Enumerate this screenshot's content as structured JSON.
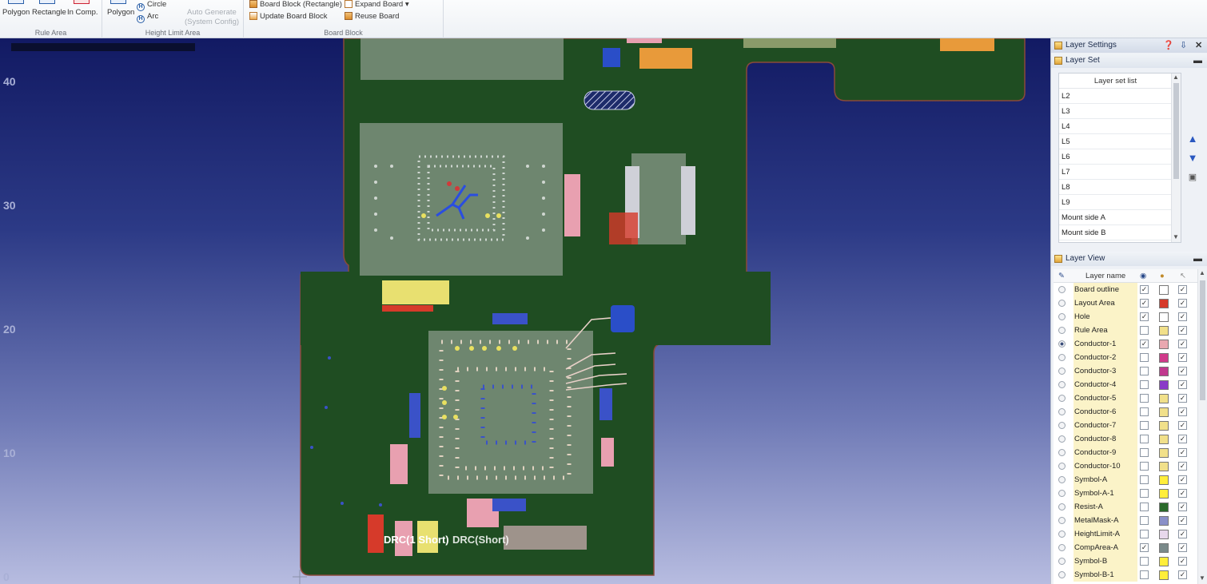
{
  "ribbon": {
    "groups": [
      {
        "label": "Rule Area",
        "buttons": [
          "Polygon",
          "Rectangle",
          "In Comp."
        ]
      },
      {
        "label": "Height Limit Area",
        "buttons": [
          "Polygon",
          "Circle",
          "Arc",
          "Auto Generate",
          "(System Config)"
        ]
      },
      {
        "label": "Board Block",
        "buttons": [
          "Board Block (Rectangle)",
          "Update Board Block",
          "Expand Board",
          "Reuse Board"
        ]
      }
    ]
  },
  "canvas": {
    "y_ticks": [
      "40",
      "30",
      "20",
      "10",
      "0"
    ],
    "drc_label": "DRC(1 Short)",
    "drc_label_overlap": "DRC(Short)"
  },
  "panel": {
    "title": "Layer Settings",
    "layer_set": {
      "title": "Layer Set",
      "list_header": "Layer set list",
      "items": [
        "L2",
        "L3",
        "L4",
        "L5",
        "L6",
        "L7",
        "L8",
        "L9",
        "Mount side A",
        "Mount side B"
      ]
    },
    "layer_view": {
      "title": "Layer View",
      "column_header": "Layer name",
      "layers": [
        {
          "name": "Board outline",
          "visible": true,
          "color": "#ffffff",
          "selectable": true,
          "active": false
        },
        {
          "name": "Layout Area",
          "visible": true,
          "color": "#d63a2a",
          "selectable": true,
          "active": false
        },
        {
          "name": "Hole",
          "visible": true,
          "color": "#ffffff",
          "selectable": true,
          "active": false
        },
        {
          "name": "Rule Area",
          "visible": false,
          "color": "#f1e08a",
          "selectable": true,
          "active": false
        },
        {
          "name": "Conductor-1",
          "visible": true,
          "color": "#e9a8b0",
          "selectable": true,
          "active": true
        },
        {
          "name": "Conductor-2",
          "visible": false,
          "color": "#d03a8a",
          "selectable": true,
          "active": false
        },
        {
          "name": "Conductor-3",
          "visible": false,
          "color": "#c0388e",
          "selectable": true,
          "active": false
        },
        {
          "name": "Conductor-4",
          "visible": false,
          "color": "#8a3ac8",
          "selectable": true,
          "active": false
        },
        {
          "name": "Conductor-5",
          "visible": false,
          "color": "#f1e08a",
          "selectable": true,
          "active": false
        },
        {
          "name": "Conductor-6",
          "visible": false,
          "color": "#f1e08a",
          "selectable": true,
          "active": false
        },
        {
          "name": "Conductor-7",
          "visible": false,
          "color": "#f1e08a",
          "selectable": true,
          "active": false
        },
        {
          "name": "Conductor-8",
          "visible": false,
          "color": "#f1e08a",
          "selectable": true,
          "active": false
        },
        {
          "name": "Conductor-9",
          "visible": false,
          "color": "#f1e08a",
          "selectable": true,
          "active": false
        },
        {
          "name": "Conductor-10",
          "visible": false,
          "color": "#f1e08a",
          "selectable": true,
          "active": false
        },
        {
          "name": "Symbol-A",
          "visible": false,
          "color": "#ffee3a",
          "selectable": true,
          "active": false
        },
        {
          "name": "Symbol-A-1",
          "visible": false,
          "color": "#ffee3a",
          "selectable": true,
          "active": false
        },
        {
          "name": "Resist-A",
          "visible": false,
          "color": "#2a6a2a",
          "selectable": true,
          "active": false
        },
        {
          "name": "MetalMask-A",
          "visible": false,
          "color": "#8a90c8",
          "selectable": true,
          "active": false
        },
        {
          "name": "HeightLimit-A",
          "visible": false,
          "color": "#e8d8ec",
          "selectable": true,
          "active": false
        },
        {
          "name": "CompArea-A",
          "visible": true,
          "color": "#7a8a8a",
          "selectable": true,
          "active": false
        },
        {
          "name": "Symbol-B",
          "visible": false,
          "color": "#ffee3a",
          "selectable": true,
          "active": false
        },
        {
          "name": "Symbol-B-1",
          "visible": false,
          "color": "#ffee3a",
          "selectable": true,
          "active": false
        }
      ]
    }
  }
}
